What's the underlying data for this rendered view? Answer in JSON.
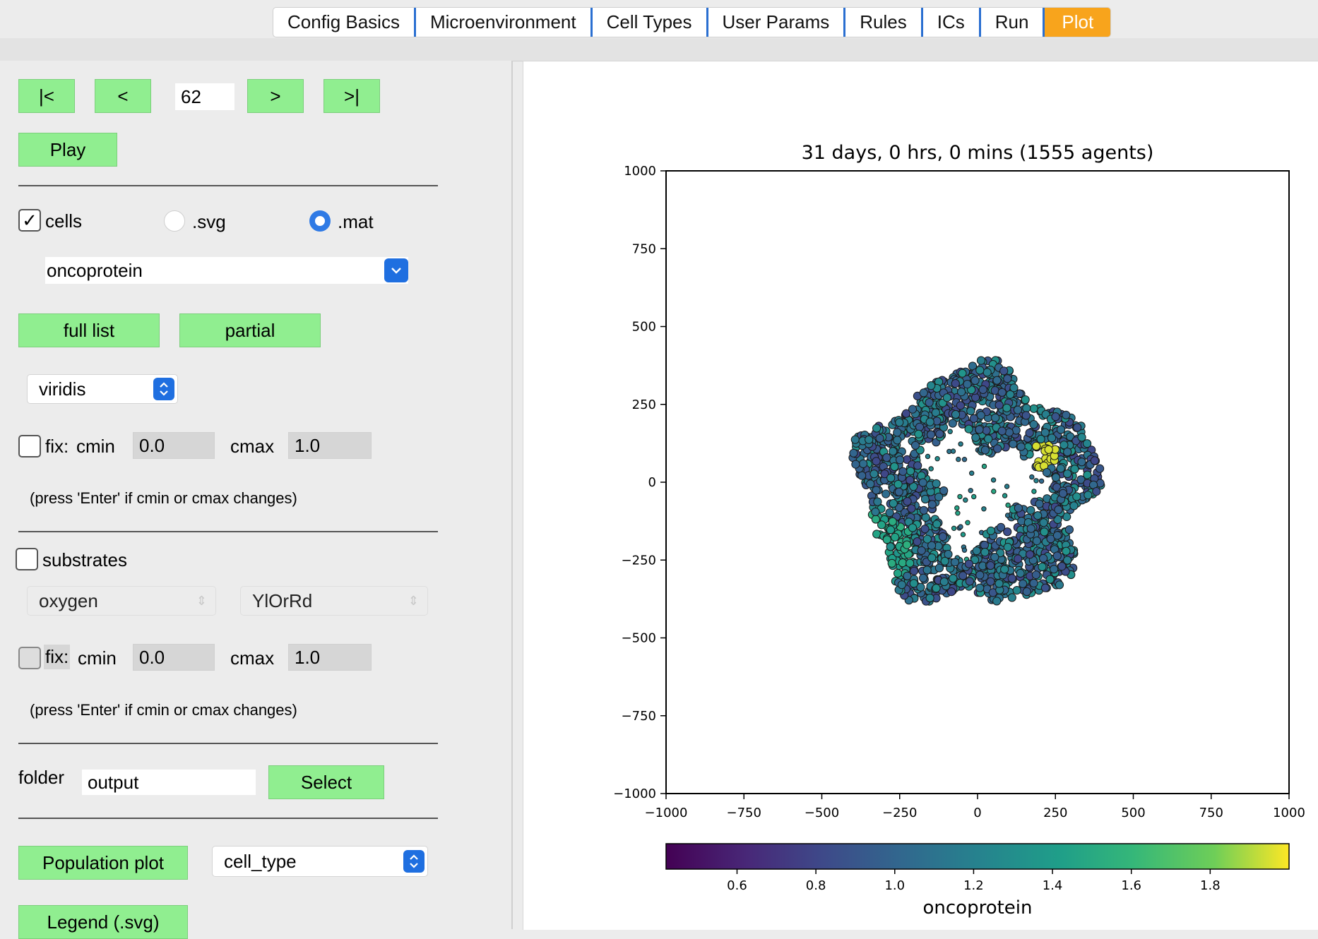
{
  "tabs": [
    {
      "label": "Config Basics",
      "active": false
    },
    {
      "label": "Microenvironment",
      "active": false
    },
    {
      "label": "Cell Types",
      "active": false
    },
    {
      "label": "User Params",
      "active": false
    },
    {
      "label": "Rules",
      "active": false
    },
    {
      "label": "ICs",
      "active": false
    },
    {
      "label": "Run",
      "active": false
    },
    {
      "label": "Plot",
      "active": true
    }
  ],
  "nav": {
    "first": "|<",
    "prev": "<",
    "frame": "62",
    "next": ">",
    "last": ">|",
    "play": "Play"
  },
  "cells": {
    "checkbox_label": "cells",
    "checked": true,
    "svg_label": ".svg",
    "mat_label": ".mat",
    "selected_format": ".mat",
    "variable": "oncoprotein",
    "full_list": "full list",
    "partial": "partial",
    "colormap": "viridis",
    "fix_label": "fix:",
    "cmin_label": "cmin",
    "cmin": "0.0",
    "cmax_label": "cmax",
    "cmax": "1.0",
    "hint": "(press 'Enter' if cmin or cmax changes)"
  },
  "substrates": {
    "checkbox_label": "substrates",
    "checked": false,
    "substrate": "oxygen",
    "colormap": "YlOrRd",
    "fix_label": "fix:",
    "cmin_label": "cmin",
    "cmin": "0.0",
    "cmax_label": "cmax",
    "cmax": "1.0",
    "hint": "(press 'Enter' if cmin or cmax changes)"
  },
  "folder": {
    "label": "folder",
    "value": "output",
    "select": "Select"
  },
  "population": {
    "button": "Population plot",
    "selection": "cell_type",
    "legend": "Legend (.svg)"
  },
  "chart_data": {
    "type": "scatter",
    "title": "31 days, 0 hrs, 0 mins (1555 agents)",
    "xlim": [
      -1000,
      1000
    ],
    "ylim": [
      -1000,
      1000
    ],
    "xticks": [
      -1000,
      -750,
      -500,
      -250,
      0,
      250,
      500,
      750,
      1000
    ],
    "yticks": [
      -1000,
      -750,
      -500,
      -250,
      0,
      250,
      500,
      750,
      1000
    ],
    "colorbar": {
      "label": "oncoprotein",
      "colormap": "viridis",
      "range": [
        0.42,
        2.0
      ],
      "ticks": [
        0.6,
        0.8,
        1.0,
        1.2,
        1.4,
        1.6,
        1.8
      ]
    },
    "agents": 1555,
    "colony": {
      "center": [
        0,
        -20
      ],
      "outer_radius": 400,
      "inner_radius": 190
    },
    "clusters": [
      {
        "label": "high oncoprotein",
        "center": [
          215,
          85
        ],
        "value": 1.95
      },
      {
        "label": "green region",
        "center": [
          -320,
          -220
        ],
        "value": 1.45
      }
    ]
  }
}
